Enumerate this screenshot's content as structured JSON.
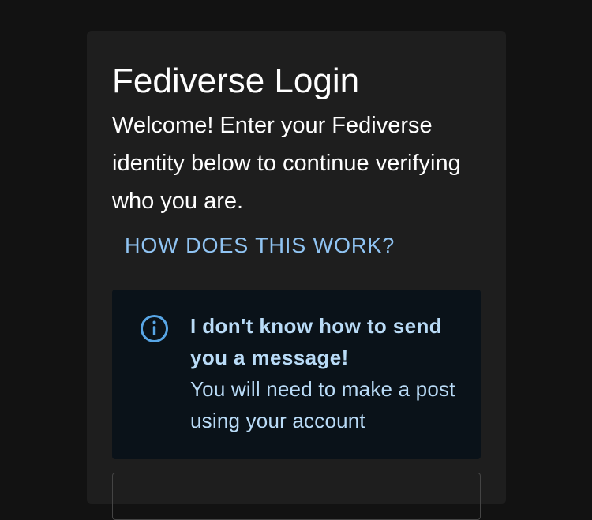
{
  "login": {
    "title": "Fediverse Login",
    "welcome_text": "Welcome! Enter your Fediverse identity below to continue verifying who you are.",
    "how_link": "HOW DOES THIS WORK?"
  },
  "alert": {
    "icon": "info-circle-icon",
    "title": "I don't know how to send you a message!",
    "body": "You will need to make a post using your account"
  },
  "colors": {
    "background": "#121212",
    "card": "#1e1e1e",
    "link": "#90c4f3",
    "alert_background": "#0a1219",
    "alert_text": "#b9dbf7"
  }
}
